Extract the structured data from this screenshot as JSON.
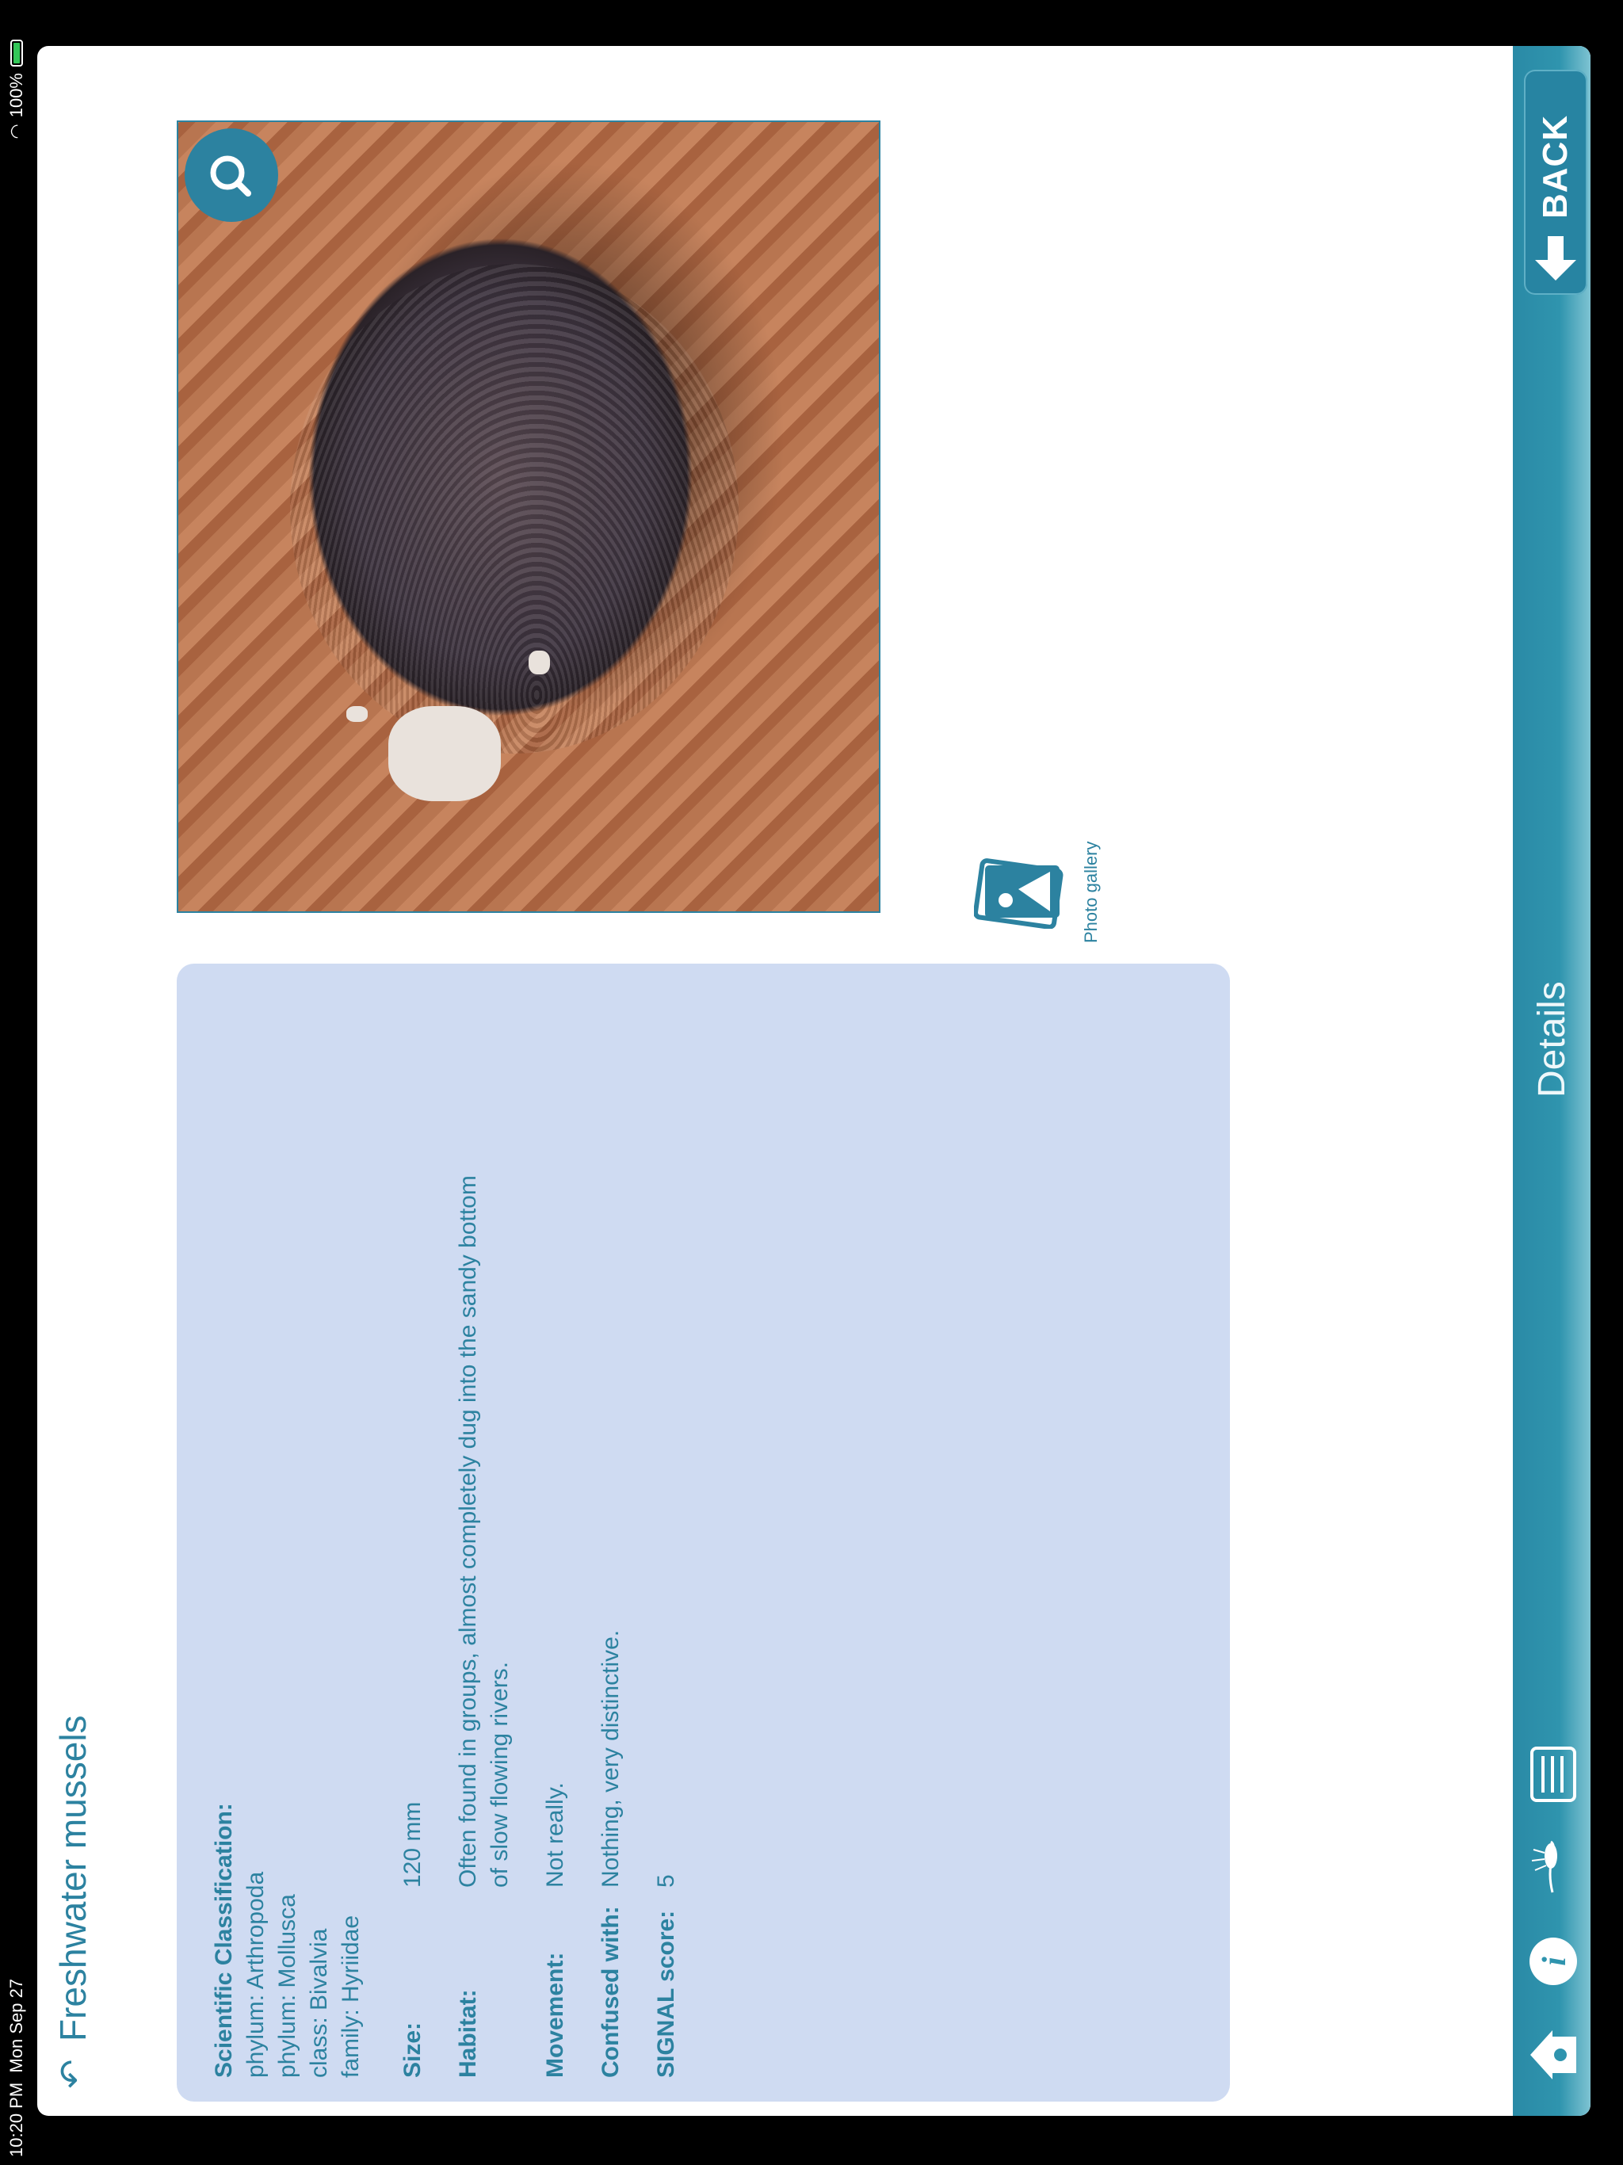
{
  "status_bar": {
    "time": "10:20 PM",
    "date": "Mon Sep 27",
    "battery": "100%"
  },
  "page": {
    "title": "Freshwater mussels",
    "undo_icon": "undo-icon"
  },
  "details": {
    "classification_label": "Scientific Classification:",
    "classification_lines": "phylum: Arthropoda\nphylum: Mollusca\nclass: Bivalvia\nfamily: Hyriidae",
    "rows": [
      {
        "label": "Size:",
        "value": "120 mm"
      },
      {
        "label": "Habitat:",
        "value": "Often found in groups, almost completely dug into the sandy bottom\nof slow flowing rivers."
      },
      {
        "label": "Movement:",
        "value": "Not really."
      },
      {
        "label": "Confused with:",
        "value": "Nothing, very distinctive."
      },
      {
        "label": "SIGNAL score:",
        "value": "5"
      }
    ]
  },
  "photo": {
    "zoom_icon": "magnifier-icon"
  },
  "gallery": {
    "label": "Photo gallery",
    "icon": "photo-gallery-icon"
  },
  "toolbar": {
    "title": "Details",
    "back_label": "BACK",
    "icons": [
      "home-icon",
      "info-icon",
      "creature-icon",
      "key-list-icon"
    ]
  },
  "colors": {
    "accent": "#2c82a0",
    "card": "#cfdbf2",
    "toolbar": "#2f94ae"
  }
}
